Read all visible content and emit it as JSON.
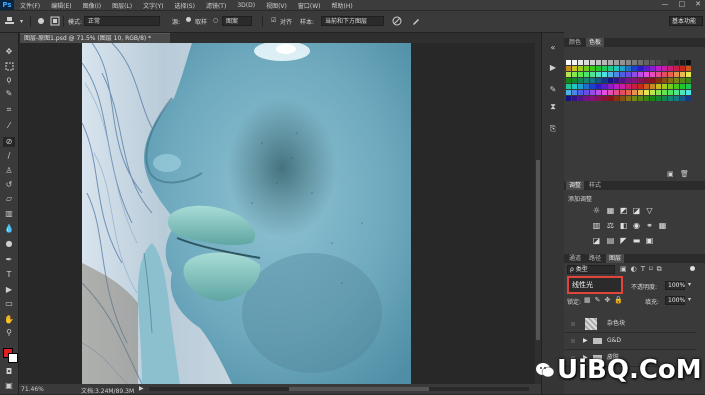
{
  "app": {
    "logo": "Ps"
  },
  "menu": [
    "文件(F)",
    "编辑(E)",
    "图像(I)",
    "图层(L)",
    "文字(Y)",
    "选择(S)",
    "滤镜(T)",
    "3D(D)",
    "视图(V)",
    "窗口(W)",
    "帮助(H)"
  ],
  "window_controls": [
    "—",
    "□",
    "✕"
  ],
  "options": {
    "mode_label": "模式:",
    "mode_value": "正常",
    "source_label": "源:",
    "source_sampled": "取样",
    "source_pattern": "图案",
    "aligned_label": "对齐",
    "sample_label": "样本:",
    "sample_value": "当前和下方图层",
    "workspace": "基本功能"
  },
  "document": {
    "tab_title": "图层-原图1.psd @ 71.5% (图层 10, RGB/8) *",
    "zoom": "71.46%",
    "doc_info": "文档:3.24M/89.3M"
  },
  "panels": {
    "color_tab": "颜色",
    "swatches_tab": "色板",
    "adjustments_tab": "调整",
    "styles_tab": "样式",
    "add_adjustment": "添加调整",
    "channels_tab": "通道",
    "paths_tab": "路径",
    "layers_tab": "图层",
    "filter_kind": "ρ 类型",
    "blend_mode": "线性光",
    "opacity_label": "不透明度:",
    "opacity_value": "100%",
    "fill_label": "填充:",
    "fill_value": "100%",
    "lock_label": "锁定:",
    "layers": [
      {
        "name": "杂色块",
        "type": "layer"
      },
      {
        "name": "G&D",
        "type": "group"
      },
      {
        "name": "皮肤",
        "type": "layer"
      }
    ]
  },
  "watermark": "UiBQ.CoM",
  "colors": {
    "chrome": "#3a3a3a",
    "canvas_bg": "#282828",
    "highlight_red": "#e0443a",
    "foreground_swatch": "#e02020",
    "background_swatch": "#ffffff"
  }
}
